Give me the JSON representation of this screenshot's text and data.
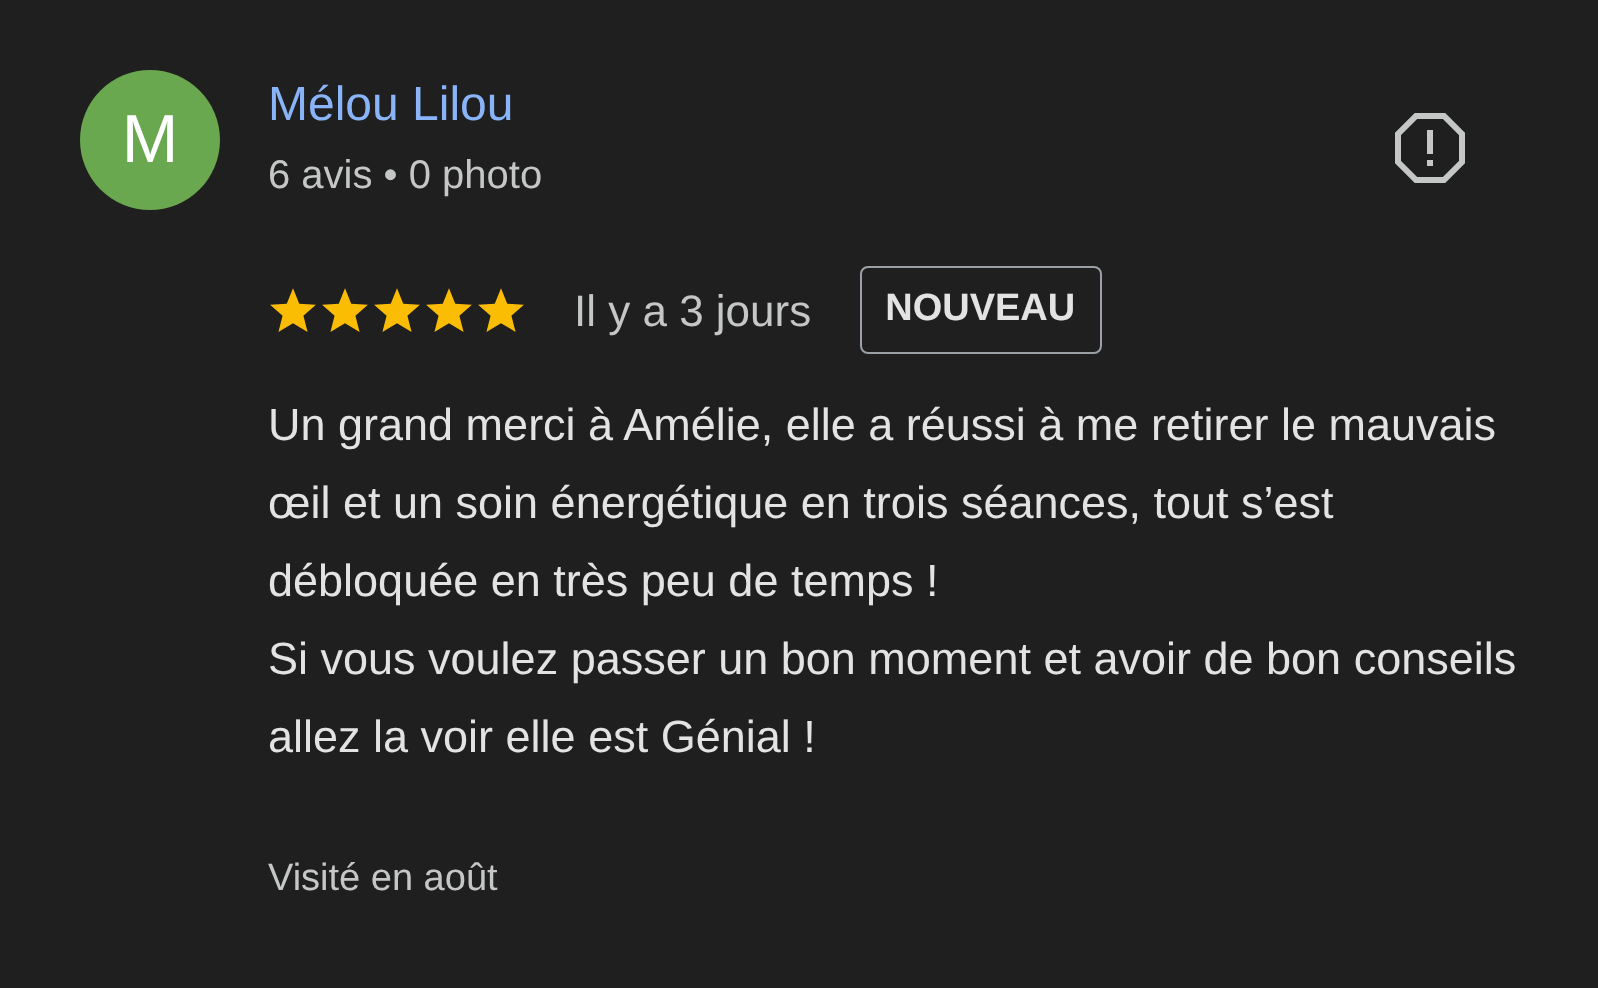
{
  "review": {
    "avatar_letter": "M",
    "author": "Mélou Lilou",
    "author_stats": "6 avis • 0 photo",
    "stars": 5,
    "time": "Il y a 3 jours",
    "badge": "NOUVEAU",
    "paragraphs": [
      "Un grand merci à Amélie, elle a réussi à me retirer le mauvais œil et un soin énergétique en trois séances, tout s’est débloquée en très peu de temps !",
      "Si vous voulez passer un bon moment et avoir de bon conseils allez la voir elle est Génial !"
    ],
    "visit": "Visité en août"
  }
}
